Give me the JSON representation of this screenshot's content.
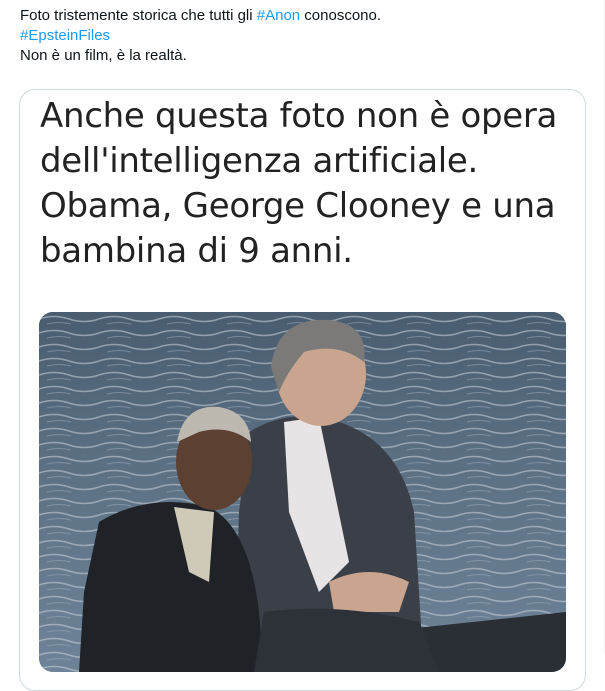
{
  "tweet": {
    "line1_before": "Foto tristemente storica che tutti gli ",
    "line1_hashtag": "#Anon",
    "line1_after": " conoscono.",
    "line2_hashtag": "#EpsteinFiles",
    "line3": "Non è un film, è la realtà."
  },
  "media": {
    "caption_lines": [
      "Anche questa foto non è opera",
      "dell'intelligenza artificiale.",
      "Obama, George Clooney e una",
      "bambina di 9 anni."
    ]
  },
  "colors": {
    "hashtag": "#1d9bf0",
    "text": "#0f1419",
    "border": "#cfd9de"
  }
}
